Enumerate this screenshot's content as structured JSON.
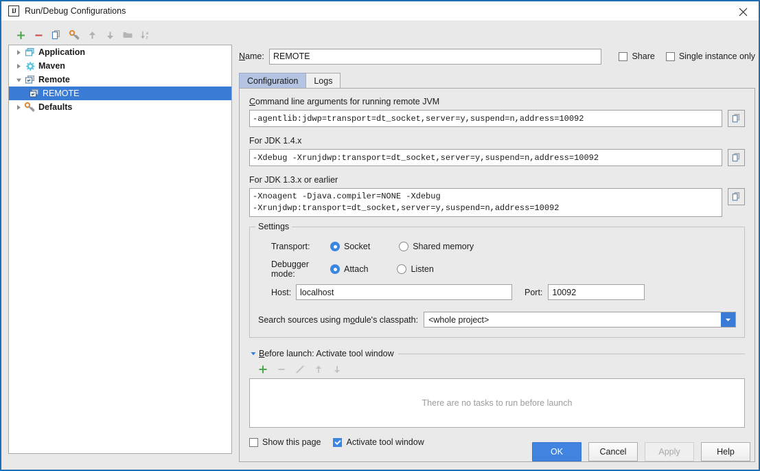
{
  "window": {
    "title": "Run/Debug Configurations",
    "app_icon": "intellij-idea-icon",
    "close_icon": "close-icon",
    "accent_blue": "#1f6fb6",
    "selection_blue": "#3a7bd5",
    "background": "#e9e9e9"
  },
  "tree_toolbar": {
    "buttons": [
      {
        "name": "add-configuration-button",
        "icon": "plus-icon",
        "color": "#4ca64c",
        "enabled": true
      },
      {
        "name": "remove-configuration-button",
        "icon": "minus-icon",
        "color": "#cc4b4b",
        "enabled": true
      },
      {
        "name": "copy-configuration-button",
        "icon": "copy-icon",
        "color": "#5a8ec0",
        "enabled": true
      },
      {
        "name": "edit-defaults-button",
        "icon": "wrench-icon",
        "color": "#e08a2e",
        "enabled": true
      },
      {
        "name": "move-up-button",
        "icon": "arrow-up-icon",
        "color": "#b0b0b0",
        "enabled": false
      },
      {
        "name": "move-down-button",
        "icon": "arrow-down-icon",
        "color": "#b0b0b0",
        "enabled": false
      },
      {
        "name": "new-folder-button",
        "icon": "folder-icon",
        "color": "#b0b0b0",
        "enabled": false
      },
      {
        "name": "sort-alphabetically-button",
        "icon": "sort-az-icon",
        "color": "#b0b0b0",
        "enabled": false
      }
    ]
  },
  "tree": {
    "items": [
      {
        "label": "Application",
        "icon": "application-icon",
        "expanded": false,
        "level": 0,
        "selected": false
      },
      {
        "label": "Maven",
        "icon": "maven-gear-icon",
        "expanded": false,
        "level": 0,
        "selected": false
      },
      {
        "label": "Remote",
        "icon": "remote-icon",
        "expanded": true,
        "level": 0,
        "selected": false
      },
      {
        "label": "REMOTE",
        "icon": "remote-icon",
        "expanded": null,
        "level": 1,
        "selected": true
      },
      {
        "label": "Defaults",
        "icon": "wrench-icon",
        "expanded": false,
        "level": 0,
        "selected": false
      }
    ]
  },
  "name_row": {
    "label": "Name:",
    "value": "REMOTE",
    "placeholder": "",
    "share": {
      "label": "Share",
      "checked": false
    },
    "single_instance": {
      "label": "Single instance only",
      "checked": false
    }
  },
  "tabs": [
    {
      "label": "Configuration",
      "active": true
    },
    {
      "label": "Logs",
      "active": false
    }
  ],
  "configuration": {
    "cmdline": {
      "label": "Command line arguments for running remote JVM",
      "value": "-agentlib:jdwp=transport=dt_socket,server=y,suspend=n,address=10092",
      "copy_icon": "copy-icon"
    },
    "jdk14": {
      "label": "For JDK 1.4.x",
      "value": "-Xdebug -Xrunjdwp:transport=dt_socket,server=y,suspend=n,address=10092",
      "copy_icon": "copy-icon"
    },
    "jdk13": {
      "label": "For JDK 1.3.x or earlier",
      "value": "-Xnoagent -Djava.compiler=NONE -Xdebug\n-Xrunjdwp:transport=dt_socket,server=y,suspend=n,address=10092",
      "copy_icon": "copy-icon"
    },
    "settings": {
      "legend": "Settings",
      "transport": {
        "label": "Transport:",
        "options": [
          {
            "label": "Socket",
            "selected": true
          },
          {
            "label": "Shared memory",
            "selected": false
          }
        ]
      },
      "debugger_mode": {
        "label": "Debugger mode:",
        "options": [
          {
            "label": "Attach",
            "selected": true
          },
          {
            "label": "Listen",
            "selected": false
          }
        ]
      },
      "host": {
        "label": "Host:",
        "value": "localhost",
        "placeholder": ""
      },
      "port": {
        "label": "Port:",
        "value": "10092",
        "placeholder": ""
      },
      "search_sources": {
        "label": "Search sources using module's classpath:",
        "value": "<whole project>",
        "dropdown_icon": "chevron-down-icon"
      }
    }
  },
  "before_launch": {
    "title": "Before launch: Activate tool window",
    "expanded": true,
    "twisty_icon": "triangle-down-icon",
    "toolbar": [
      {
        "name": "add-task-button",
        "icon": "plus-icon",
        "color": "#4ca64c",
        "enabled": true
      },
      {
        "name": "remove-task-button",
        "icon": "minus-icon",
        "color": "#c4c4c4",
        "enabled": false
      },
      {
        "name": "edit-task-button",
        "icon": "pencil-icon",
        "color": "#c4c4c4",
        "enabled": false
      },
      {
        "name": "move-task-up-button",
        "icon": "arrow-up-icon",
        "color": "#c4c4c4",
        "enabled": false
      },
      {
        "name": "move-task-down-button",
        "icon": "arrow-down-icon",
        "color": "#c4c4c4",
        "enabled": false
      }
    ],
    "empty_text": "There are no tasks to run before launch",
    "show_this_page": {
      "label": "Show this page",
      "checked": false
    },
    "activate_tool_window": {
      "label": "Activate tool window",
      "checked": true
    }
  },
  "footer": {
    "buttons": [
      {
        "label": "OK",
        "style": "primary",
        "enabled": true
      },
      {
        "label": "Cancel",
        "style": "default",
        "enabled": true
      },
      {
        "label": "Apply",
        "style": "disabled",
        "enabled": false
      },
      {
        "label": "Help",
        "style": "default",
        "enabled": true
      }
    ]
  }
}
